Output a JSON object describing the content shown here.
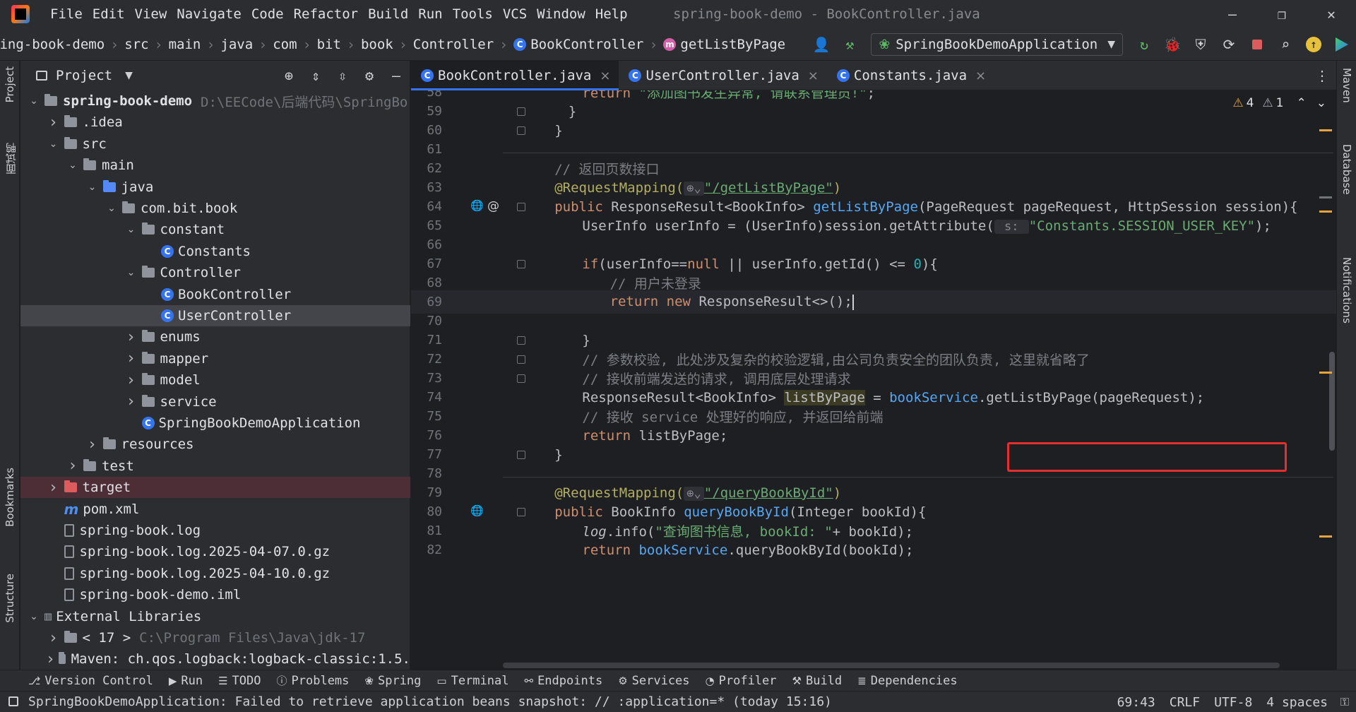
{
  "window": {
    "title": "spring-book-demo - BookController.java",
    "menu": [
      "File",
      "Edit",
      "View",
      "Navigate",
      "Code",
      "Refactor",
      "Build",
      "Run",
      "Tools",
      "VCS",
      "Window",
      "Help"
    ]
  },
  "breadcrumbs": [
    "ring-book-demo",
    "src",
    "main",
    "java",
    "com",
    "bit",
    "book",
    "Controller",
    "BookController",
    "getListByPage"
  ],
  "run_config": "SpringBookDemoApplication",
  "project_panel": {
    "title": "Project",
    "tree": [
      {
        "label": "spring-book-demo",
        "hint": "D:\\EECode\\后端代码\\SpringBo",
        "bold": true
      },
      {
        "label": ".idea"
      },
      {
        "label": "src"
      },
      {
        "label": "main"
      },
      {
        "label": "java"
      },
      {
        "label": "com.bit.book"
      },
      {
        "label": "constant"
      },
      {
        "label": "Constants"
      },
      {
        "label": "Controller"
      },
      {
        "label": "BookController"
      },
      {
        "label": "UserController"
      },
      {
        "label": "enums"
      },
      {
        "label": "mapper"
      },
      {
        "label": "model"
      },
      {
        "label": "service"
      },
      {
        "label": "SpringBookDemoApplication"
      },
      {
        "label": "resources"
      },
      {
        "label": "test"
      },
      {
        "label": "target"
      },
      {
        "label": "pom.xml"
      },
      {
        "label": "spring-book.log"
      },
      {
        "label": "spring-book.log.2025-04-07.0.gz"
      },
      {
        "label": "spring-book.log.2025-04-10.0.gz"
      },
      {
        "label": "spring-book-demo.iml"
      },
      {
        "label": "External Libraries"
      },
      {
        "label": "< 17 >",
        "hint": "C:\\Program Files\\Java\\jdk-17"
      },
      {
        "label": "Maven: ch.qos.logback:logback-classic:1.5."
      }
    ]
  },
  "tabs": [
    {
      "label": "BookController.java",
      "active": true
    },
    {
      "label": "UserController.java"
    },
    {
      "label": "Constants.java"
    }
  ],
  "editor": {
    "warnings": "4",
    "weak_warnings": "1",
    "lines": [
      {
        "n": "58",
        "parts": [
          [
            "return ",
            "kw"
          ],
          [
            "\"添加图书发生异常, 请联系管理员!\"",
            "str"
          ],
          [
            ";",
            ""
          ]
        ],
        "indent": 8
      },
      {
        "n": "59",
        "parts": [
          [
            "}",
            ""
          ]
        ],
        "indent": 6
      },
      {
        "n": "60",
        "parts": [
          [
            "}",
            ""
          ]
        ],
        "indent": 4
      },
      {
        "n": "61",
        "parts": []
      },
      {
        "n": "62",
        "parts": [
          [
            "// 返回页数接口",
            "cmt"
          ]
        ],
        "indent": 4
      },
      {
        "n": "63",
        "parts": [
          [
            "@RequestMapping(",
            "ann"
          ],
          [
            "\"/getListByPage\"",
            "str"
          ],
          [
            ")",
            "ann"
          ]
        ],
        "indent": 4
      },
      {
        "n": "64",
        "parts": [
          [
            "public ",
            "kw"
          ],
          [
            "ResponseResult<BookInfo> ",
            ""
          ],
          [
            "getListByPage",
            "fn"
          ],
          [
            "(PageRequest pageRequest, HttpSession session){",
            ""
          ]
        ],
        "indent": 4
      },
      {
        "n": "65",
        "parts": [
          [
            "UserInfo userInfo = (UserInfo)session.getAttribute(",
            ""
          ],
          [
            " s: ",
            "hint"
          ],
          [
            "\"Constants.SESSION_USER_KEY\"",
            "str"
          ],
          [
            ");",
            ""
          ]
        ],
        "indent": 8
      },
      {
        "n": "66",
        "parts": []
      },
      {
        "n": "67",
        "parts": [
          [
            "if",
            "kw"
          ],
          [
            "(userInfo==",
            ""
          ],
          [
            "null",
            "kw"
          ],
          [
            " || userInfo.getId() <= ",
            ""
          ],
          [
            "0",
            "num"
          ],
          [
            "){",
            ""
          ]
        ],
        "indent": 8
      },
      {
        "n": "68",
        "parts": [
          [
            "// 用户未登录",
            "cmt"
          ]
        ],
        "indent": 12
      },
      {
        "n": "69",
        "parts": [
          [
            "return ",
            "kw"
          ],
          [
            "new ",
            "kw"
          ],
          [
            "ResponseResult<>();",
            ""
          ]
        ],
        "indent": 12
      },
      {
        "n": "70",
        "parts": []
      },
      {
        "n": "71",
        "parts": [
          [
            "}",
            ""
          ]
        ],
        "indent": 8
      },
      {
        "n": "72",
        "parts": [
          [
            "// 参数校验, 此处涉及复杂的校验逻辑,由公司负责安全的团队负责, 这里就省略了",
            "cmt"
          ]
        ],
        "indent": 8
      },
      {
        "n": "73",
        "parts": [
          [
            "// 接收前端发送的请求, 调用底层处理请求",
            "cmt"
          ]
        ],
        "indent": 8
      },
      {
        "n": "74",
        "parts": [
          [
            "ResponseResult<BookInfo> ",
            ""
          ],
          [
            "listByPage",
            "hlvar"
          ],
          [
            " = ",
            ""
          ],
          [
            "bookService",
            "fld"
          ],
          [
            ".getListByPage(pageRequest);",
            ""
          ]
        ],
        "indent": 8
      },
      {
        "n": "75",
        "parts": [
          [
            "// 接收 service 处理好的响应, 并返回给前端",
            "cmt"
          ]
        ],
        "indent": 8
      },
      {
        "n": "76",
        "parts": [
          [
            "return ",
            "kw"
          ],
          [
            "listByPage;",
            ""
          ]
        ],
        "indent": 8
      },
      {
        "n": "77",
        "parts": [
          [
            "}",
            ""
          ]
        ],
        "indent": 4
      },
      {
        "n": "78",
        "parts": []
      },
      {
        "n": "79",
        "parts": [
          [
            "@RequestMapping(",
            "ann"
          ],
          [
            "\"/queryBookById\"",
            "str"
          ],
          [
            ")",
            "ann"
          ]
        ],
        "indent": 4
      },
      {
        "n": "80",
        "parts": [
          [
            "public ",
            "kw"
          ],
          [
            "BookInfo ",
            ""
          ],
          [
            "queryBookById",
            "fn"
          ],
          [
            "(Integer bookId){",
            ""
          ]
        ],
        "indent": 4
      },
      {
        "n": "81",
        "parts": [
          [
            "log",
            "it"
          ],
          [
            ".info(",
            ""
          ],
          [
            "\"查询图书信息, bookId: \"",
            "str"
          ],
          [
            "+ bookId);",
            ""
          ]
        ],
        "indent": 8
      },
      {
        "n": "82",
        "parts": [
          [
            "return ",
            "kw"
          ],
          [
            "bookService",
            "fld"
          ],
          [
            ".queryBookById(bookId);",
            ""
          ]
        ],
        "indent": 8
      }
    ]
  },
  "tool_windows": [
    "Version Control",
    "Run",
    "TODO",
    "Problems",
    "Spring",
    "Terminal",
    "Endpoints",
    "Services",
    "Profiler",
    "Build",
    "Dependencies"
  ],
  "left_stripe": [
    "Project",
    "面试鸭",
    "Bookmarks",
    "Structure"
  ],
  "right_stripe": [
    "Maven",
    "Database",
    "Notifications"
  ],
  "status": {
    "message": "SpringBookDemoApplication: Failed to retrieve application beans snapshot: // :application=* (today 15:16)",
    "position": "69:43",
    "line_sep": "CRLF",
    "encoding": "UTF-8",
    "indent": "4 spaces"
  }
}
